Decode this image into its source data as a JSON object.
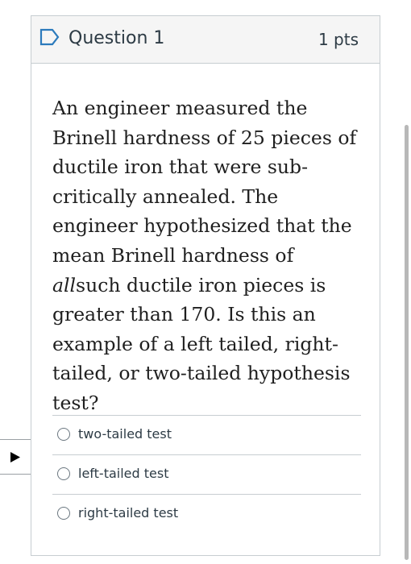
{
  "question": {
    "title": "Question 1",
    "points": "1 pts",
    "text_before": "An engineer measured the Brinell hardness of 25 pieces of ductile iron that were sub-critically annealed. The engineer hypothesized that the mean Brinell hardness of ",
    "text_emphasis": "all",
    "text_after": "such ductile iron pieces is greater than 170.  Is this an example of a left tailed, right-tailed, or two-tailed hypothesis test?"
  },
  "answers": [
    {
      "label": "two-tailed test",
      "selected": false
    },
    {
      "label": "left-tailed test",
      "selected": false
    },
    {
      "label": "right-tailed test",
      "selected": false
    }
  ],
  "icons": {
    "flag": "flag-outline-icon",
    "play": "play-triangle-icon",
    "radio": "radio-unchecked-icon"
  },
  "colors": {
    "flag_blue": "#2b7abc",
    "header_bg": "#f5f5f5",
    "border": "#c7cdd1",
    "text": "#2d3b45"
  }
}
